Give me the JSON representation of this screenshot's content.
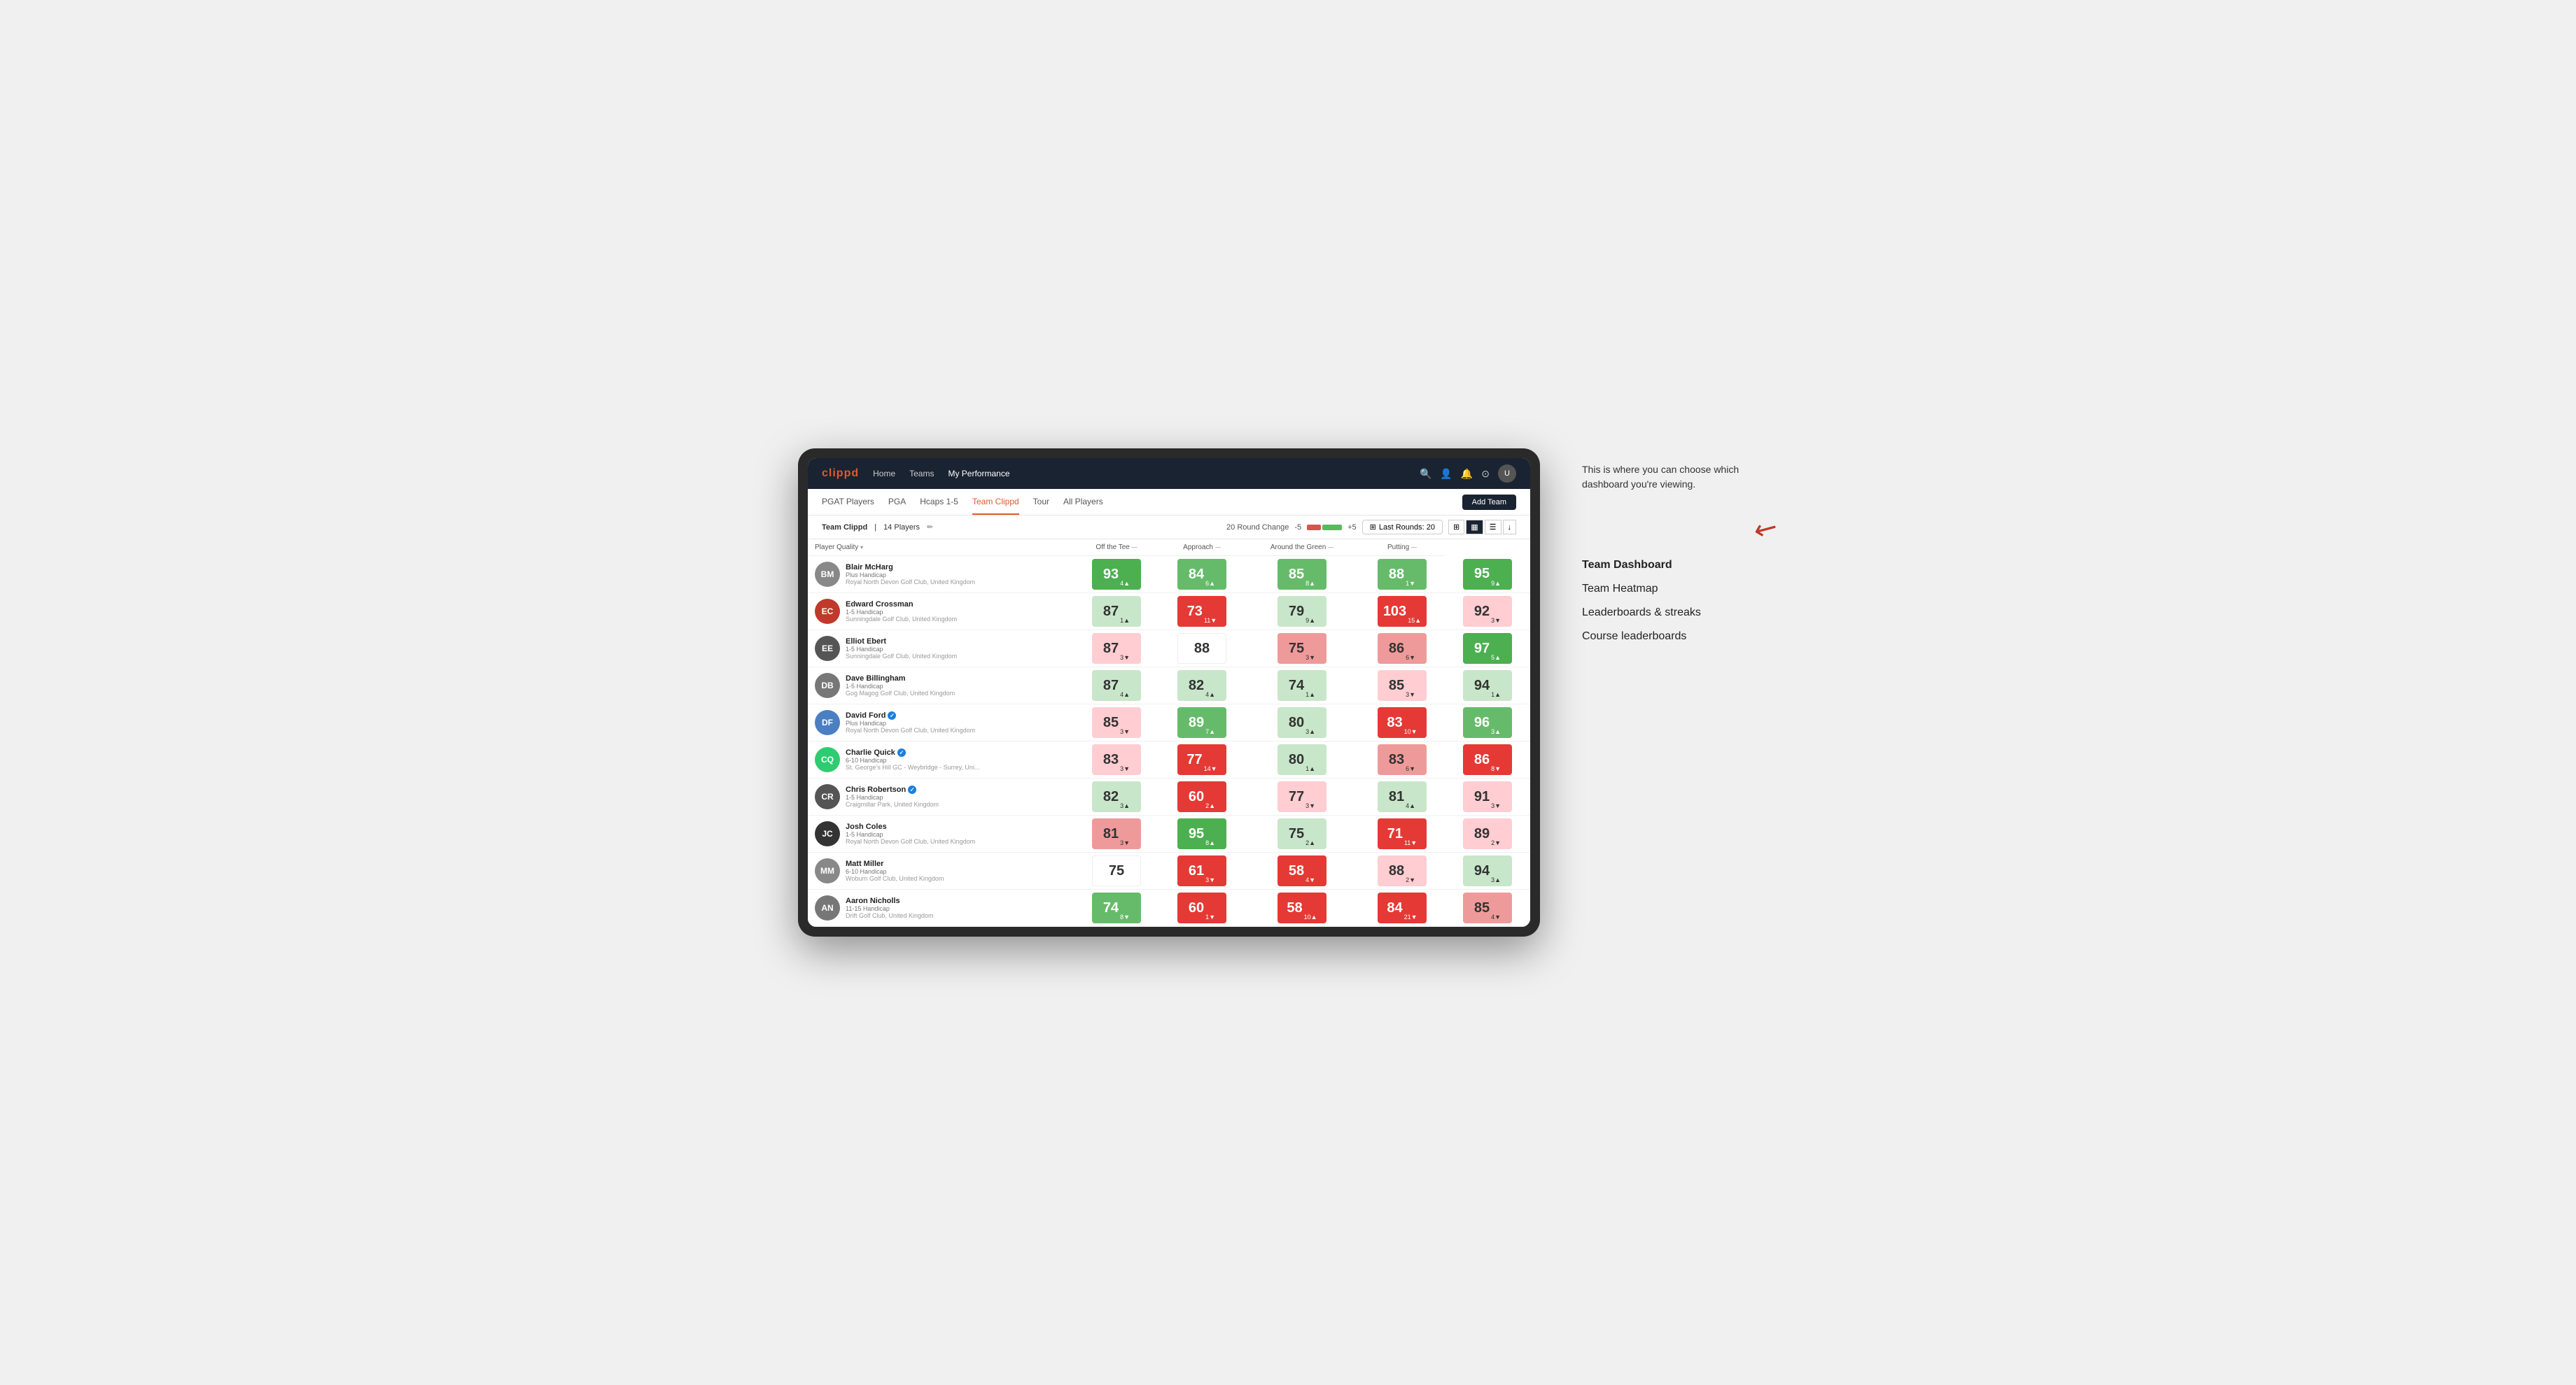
{
  "annotation": {
    "description": "This is where you can choose which dashboard you're viewing.",
    "menu_items": [
      {
        "id": "team-dashboard",
        "label": "Team Dashboard",
        "active": true
      },
      {
        "id": "team-heatmap",
        "label": "Team Heatmap",
        "active": false
      },
      {
        "id": "leaderboards",
        "label": "Leaderboards & streaks",
        "active": false
      },
      {
        "id": "course-leaderboards",
        "label": "Course leaderboards",
        "active": false
      }
    ]
  },
  "nav": {
    "logo": "clippd",
    "links": [
      {
        "label": "Home",
        "active": false
      },
      {
        "label": "Teams",
        "active": false
      },
      {
        "label": "My Performance",
        "active": true
      }
    ],
    "icons": [
      "search",
      "person",
      "bell",
      "settings",
      "avatar"
    ]
  },
  "sub_nav": {
    "links": [
      {
        "label": "PGAT Players",
        "active": false
      },
      {
        "label": "PGA",
        "active": false
      },
      {
        "label": "Hcaps 1-5",
        "active": false
      },
      {
        "label": "Team Clippd",
        "active": true
      },
      {
        "label": "Tour",
        "active": false
      },
      {
        "label": "All Players",
        "active": false
      }
    ],
    "add_team_label": "Add Team"
  },
  "team_header": {
    "name": "Team Clippd",
    "separator": "|",
    "players_count": "14 Players",
    "round_change_label": "20 Round Change",
    "change_min": "-5",
    "change_max": "+5",
    "last_rounds_label": "Last Rounds:",
    "last_rounds_value": "20"
  },
  "table": {
    "columns": [
      {
        "id": "player",
        "label": "Player Quality",
        "sortable": true
      },
      {
        "id": "off_tee",
        "label": "Off the Tee",
        "sortable": true
      },
      {
        "id": "approach",
        "label": "Approach",
        "sortable": true
      },
      {
        "id": "around_green",
        "label": "Around the Green",
        "sortable": true
      },
      {
        "id": "putting",
        "label": "Putting",
        "sortable": true
      }
    ],
    "rows": [
      {
        "id": 1,
        "name": "Blair McHarg",
        "handicap": "Plus Handicap",
        "club": "Royal North Devon Golf Club, United Kingdom",
        "avatar_color": "#888",
        "avatar_initials": "BM",
        "verified": false,
        "scores": [
          {
            "value": 93,
            "change": 4,
            "direction": "up",
            "color": "bg-green-strong"
          },
          {
            "value": 84,
            "change": 6,
            "direction": "up",
            "color": "bg-green-mid"
          },
          {
            "value": 85,
            "change": 8,
            "direction": "up",
            "color": "bg-green-mid"
          },
          {
            "value": 88,
            "change": 1,
            "direction": "down",
            "color": "bg-green-mid"
          },
          {
            "value": 95,
            "change": 9,
            "direction": "up",
            "color": "bg-green-strong"
          }
        ]
      },
      {
        "id": 2,
        "name": "Edward Crossman",
        "handicap": "1-5 Handicap",
        "club": "Sunningdale Golf Club, United Kingdom",
        "avatar_color": "#c0392b",
        "avatar_initials": "EC",
        "verified": false,
        "scores": [
          {
            "value": 87,
            "change": 1,
            "direction": "up",
            "color": "bg-green-light"
          },
          {
            "value": 73,
            "change": 11,
            "direction": "down",
            "color": "bg-red-strong"
          },
          {
            "value": 79,
            "change": 9,
            "direction": "up",
            "color": "bg-green-light"
          },
          {
            "value": 103,
            "change": 15,
            "direction": "up",
            "color": "bg-red-strong"
          },
          {
            "value": 92,
            "change": 3,
            "direction": "down",
            "color": "bg-red-light"
          }
        ]
      },
      {
        "id": 3,
        "name": "Elliot Ebert",
        "handicap": "1-5 Handicap",
        "club": "Sunningdale Golf Club, United Kingdom",
        "avatar_color": "#555",
        "avatar_initials": "EE",
        "verified": false,
        "scores": [
          {
            "value": 87,
            "change": 3,
            "direction": "down",
            "color": "bg-red-light"
          },
          {
            "value": 88,
            "change": null,
            "direction": null,
            "color": "bg-white"
          },
          {
            "value": 75,
            "change": 3,
            "direction": "down",
            "color": "bg-red-mid"
          },
          {
            "value": 86,
            "change": 6,
            "direction": "down",
            "color": "bg-red-mid"
          },
          {
            "value": 97,
            "change": 5,
            "direction": "up",
            "color": "bg-green-strong"
          }
        ]
      },
      {
        "id": 4,
        "name": "Dave Billingham",
        "handicap": "1-5 Handicap",
        "club": "Gog Magog Golf Club, United Kingdom",
        "avatar_color": "#777",
        "avatar_initials": "DB",
        "verified": false,
        "scores": [
          {
            "value": 87,
            "change": 4,
            "direction": "up",
            "color": "bg-green-light"
          },
          {
            "value": 82,
            "change": 4,
            "direction": "up",
            "color": "bg-green-light"
          },
          {
            "value": 74,
            "change": 1,
            "direction": "up",
            "color": "bg-green-light"
          },
          {
            "value": 85,
            "change": 3,
            "direction": "down",
            "color": "bg-red-light"
          },
          {
            "value": 94,
            "change": 1,
            "direction": "up",
            "color": "bg-green-light"
          }
        ]
      },
      {
        "id": 5,
        "name": "David Ford",
        "handicap": "Plus Handicap",
        "club": "Royal North Devon Golf Club, United Kingdom",
        "avatar_color": "#4a7fc1",
        "avatar_initials": "DF",
        "verified": true,
        "scores": [
          {
            "value": 85,
            "change": 3,
            "direction": "down",
            "color": "bg-red-light"
          },
          {
            "value": 89,
            "change": 7,
            "direction": "up",
            "color": "bg-green-mid"
          },
          {
            "value": 80,
            "change": 3,
            "direction": "up",
            "color": "bg-green-light"
          },
          {
            "value": 83,
            "change": 10,
            "direction": "down",
            "color": "bg-red-strong"
          },
          {
            "value": 96,
            "change": 3,
            "direction": "up",
            "color": "bg-green-mid"
          }
        ]
      },
      {
        "id": 6,
        "name": "Charlie Quick",
        "handicap": "6-10 Handicap",
        "club": "St. George's Hill GC - Weybridge - Surrey, Uni...",
        "avatar_color": "#2ecc71",
        "avatar_initials": "CQ",
        "verified": true,
        "scores": [
          {
            "value": 83,
            "change": 3,
            "direction": "down",
            "color": "bg-red-light"
          },
          {
            "value": 77,
            "change": 14,
            "direction": "down",
            "color": "bg-red-strong"
          },
          {
            "value": 80,
            "change": 1,
            "direction": "up",
            "color": "bg-green-light"
          },
          {
            "value": 83,
            "change": 6,
            "direction": "down",
            "color": "bg-red-mid"
          },
          {
            "value": 86,
            "change": 8,
            "direction": "down",
            "color": "bg-red-strong"
          }
        ]
      },
      {
        "id": 7,
        "name": "Chris Robertson",
        "handicap": "1-5 Handicap",
        "club": "Craigmillar Park, United Kingdom",
        "avatar_color": "#555",
        "avatar_initials": "CR",
        "verified": true,
        "scores": [
          {
            "value": 82,
            "change": 3,
            "direction": "up",
            "color": "bg-green-light"
          },
          {
            "value": 60,
            "change": 2,
            "direction": "up",
            "color": "bg-red-strong"
          },
          {
            "value": 77,
            "change": 3,
            "direction": "down",
            "color": "bg-red-light"
          },
          {
            "value": 81,
            "change": 4,
            "direction": "up",
            "color": "bg-green-light"
          },
          {
            "value": 91,
            "change": 3,
            "direction": "down",
            "color": "bg-red-light"
          }
        ]
      },
      {
        "id": 8,
        "name": "Josh Coles",
        "handicap": "1-5 Handicap",
        "club": "Royal North Devon Golf Club, United Kingdom",
        "avatar_color": "#333",
        "avatar_initials": "JC",
        "verified": false,
        "scores": [
          {
            "value": 81,
            "change": 3,
            "direction": "down",
            "color": "bg-red-mid"
          },
          {
            "value": 95,
            "change": 8,
            "direction": "up",
            "color": "bg-green-strong"
          },
          {
            "value": 75,
            "change": 2,
            "direction": "up",
            "color": "bg-green-light"
          },
          {
            "value": 71,
            "change": 11,
            "direction": "down",
            "color": "bg-red-strong"
          },
          {
            "value": 89,
            "change": 2,
            "direction": "down",
            "color": "bg-red-light"
          }
        ]
      },
      {
        "id": 9,
        "name": "Matt Miller",
        "handicap": "6-10 Handicap",
        "club": "Woburn Golf Club, United Kingdom",
        "avatar_color": "#888",
        "avatar_initials": "MM",
        "verified": false,
        "scores": [
          {
            "value": 75,
            "change": null,
            "direction": null,
            "color": "bg-white"
          },
          {
            "value": 61,
            "change": 3,
            "direction": "down",
            "color": "bg-red-strong"
          },
          {
            "value": 58,
            "change": 4,
            "direction": "down",
            "color": "bg-red-strong"
          },
          {
            "value": 88,
            "change": 2,
            "direction": "down",
            "color": "bg-red-light"
          },
          {
            "value": 94,
            "change": 3,
            "direction": "up",
            "color": "bg-green-light"
          }
        ]
      },
      {
        "id": 10,
        "name": "Aaron Nicholls",
        "handicap": "11-15 Handicap",
        "club": "Drift Golf Club, United Kingdom",
        "avatar_color": "#777",
        "avatar_initials": "AN",
        "verified": false,
        "scores": [
          {
            "value": 74,
            "change": 8,
            "direction": "down",
            "color": "bg-green-mid"
          },
          {
            "value": 60,
            "change": 1,
            "direction": "down",
            "color": "bg-red-strong"
          },
          {
            "value": 58,
            "change": 10,
            "direction": "up",
            "color": "bg-red-strong"
          },
          {
            "value": 84,
            "change": 21,
            "direction": "down",
            "color": "bg-red-strong"
          },
          {
            "value": 85,
            "change": 4,
            "direction": "down",
            "color": "bg-red-mid"
          }
        ]
      }
    ]
  }
}
